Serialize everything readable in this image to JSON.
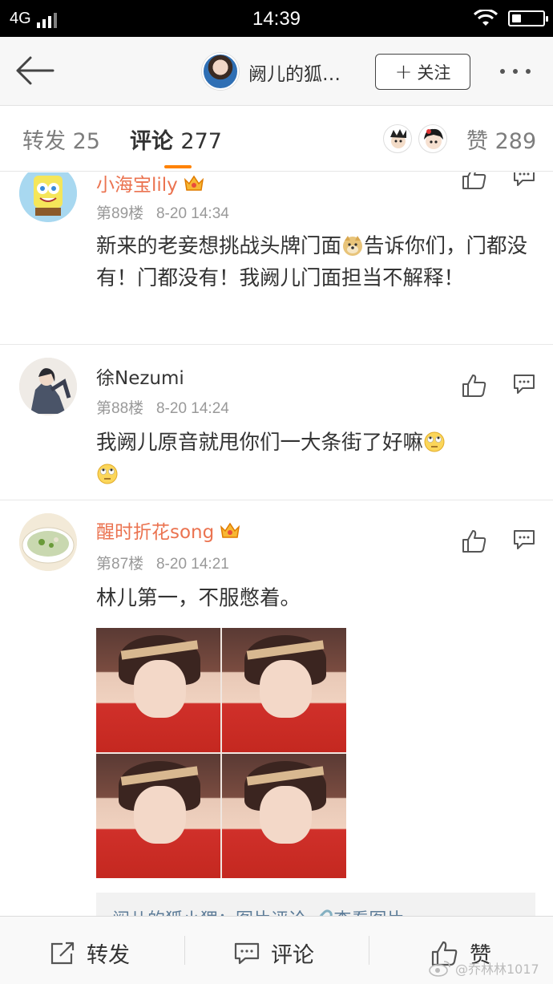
{
  "status_bar": {
    "network": "4G",
    "time": "14:39"
  },
  "nav": {
    "title": "阙儿的狐…",
    "follow_label": "关注"
  },
  "tabs": {
    "repost_label": "转发",
    "repost_count": "25",
    "comment_label": "评论",
    "comment_count": "277",
    "like_label": "赞",
    "like_count": "289"
  },
  "comments": [
    {
      "name": "小海宝lily",
      "floor": "第89楼",
      "time": "8-20 14:34",
      "text_a": "新来的老妾想挑战头牌门面",
      "text_b": "告诉你们，门都没有！门都没有！我阙儿门面担当不解释！"
    },
    {
      "name": "徐Nezumi",
      "floor": "第88楼",
      "time": "8-20 14:24",
      "text": "我阙儿原音就甩你们一大条街了好嘛"
    },
    {
      "name": "醒时折花song",
      "floor": "第87楼",
      "time": "8-20 14:21",
      "text": "林儿第一，不服憋着。",
      "quote": "阙儿的狐小狸：图片评论 🔗查看图片"
    }
  ],
  "bottom_bar": {
    "repost_label": "转发",
    "comment_label": "评论",
    "like_label": "赞",
    "watermark": "@乔林林1017"
  },
  "colors": {
    "accent": "#ff8200",
    "vip_name": "#eb7350",
    "link": "#5d7c98"
  }
}
